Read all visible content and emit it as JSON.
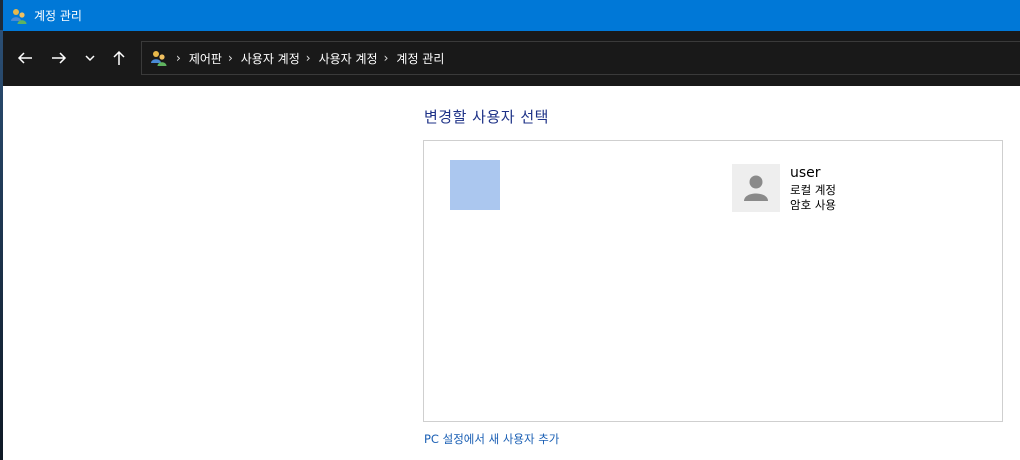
{
  "window": {
    "title": "계정 관리",
    "icon": "users-icon",
    "accent": "#0078d7"
  },
  "nav": {
    "back_icon": "arrow-left-icon",
    "forward_icon": "arrow-right-icon",
    "recent_icon": "chevron-down-icon",
    "up_icon": "arrow-up-icon"
  },
  "breadcrumb": {
    "icon": "users-icon",
    "items": [
      "제어판",
      "사용자 계정",
      "사용자 계정",
      "계정 관리"
    ]
  },
  "main": {
    "heading": "변경할 사용자 선택",
    "users": [
      {
        "name": "user",
        "type": "로컬 계정",
        "password_status": "암호 사용",
        "avatar_icon": "user-avatar-icon"
      }
    ],
    "add_user_link": "PC 설정에서 새 사용자 추가"
  },
  "colors": {
    "navbar_bg": "#191919",
    "heading": "#1e3287",
    "link": "#1a5fb4",
    "blank_tile": "#abc7ef"
  }
}
